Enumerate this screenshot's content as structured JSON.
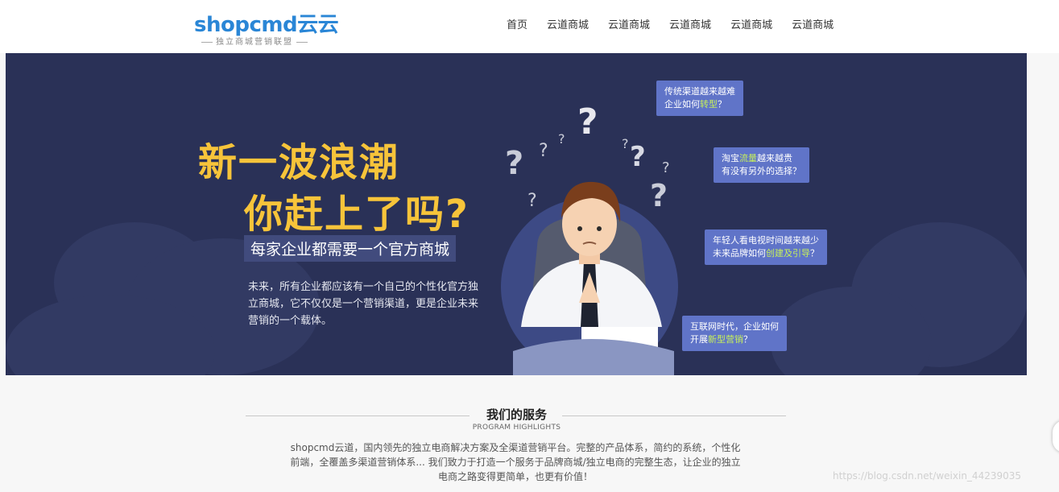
{
  "logo": {
    "brand": "shopcmd云云",
    "tagline": "独立商城营销联盟"
  },
  "nav": {
    "items": [
      "首页",
      "云道商城",
      "云道商城",
      "云道商城",
      "云道商城",
      "云道商城"
    ]
  },
  "banner": {
    "headline_line1": "新一波浪潮",
    "headline_line2": "你赶上了吗?",
    "subheadline": "每家企业都需要一个官方商城",
    "description": "未来，所有企业都应该有一个自己的个性化官方独立商城，它不仅仅是一个营销渠道，更是企业未来营销的一个载体。",
    "bubbles": [
      {
        "l1": "传统渠道越来越难",
        "l2_pre": "企业如何",
        "l2_hl": "转型",
        "l2_post": "？"
      },
      {
        "l1_pre": "淘宝",
        "l1_hl": "流量",
        "l1_post": "越来越贵",
        "l2": "有没有另外的选择？"
      },
      {
        "l1": "年轻人看电视时间越来越少",
        "l2_pre": "未来品牌如何",
        "l2_hl": "创建及引导",
        "l2_post": "？"
      },
      {
        "l1": "互联网时代，企业如何",
        "l2_pre": "开展",
        "l2_hl": "新型营销",
        "l2_post": "？"
      }
    ]
  },
  "services": {
    "title": "我们的服务",
    "subtitle": "PROGRAM HIGHLIGHTS",
    "description": "shopcmd云道，国内领先的独立电商解决方案及全渠道营销平台。完整的产品体系，简约的系统，个性化前端，全覆盖多渠道营销体系... 我们致力于打造一个服务于品牌商城/独立电商的完整生态，让企业的独立电商之路变得更简单，也更有价值！"
  },
  "watermark": "https://blog.csdn.net/weixin_44239035",
  "colors": {
    "banner_bg": "#2a3157",
    "headline": "#f7c43a",
    "bubble": "#6074c8",
    "highlight": "#c6ef5a",
    "logo": "#2a86d6"
  }
}
